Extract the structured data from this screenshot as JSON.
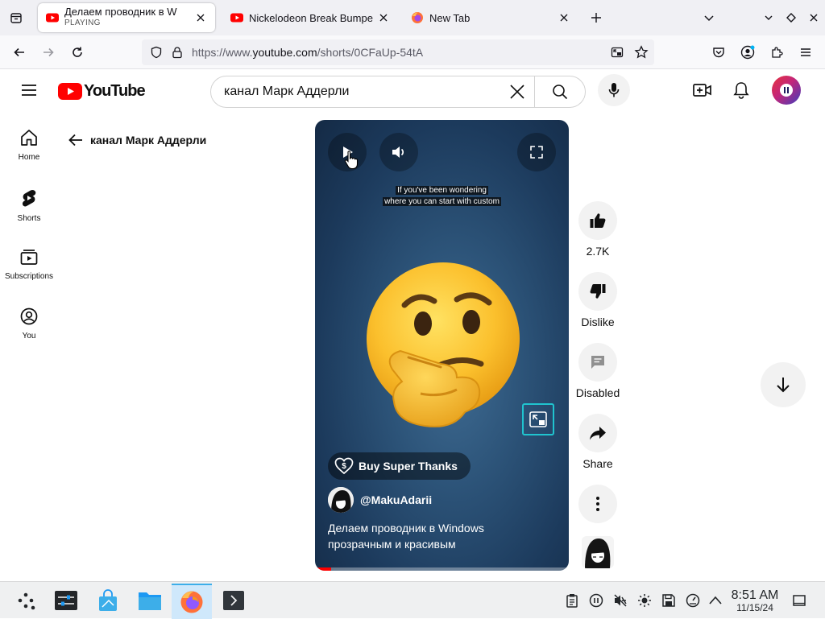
{
  "browser": {
    "tabs": [
      {
        "title": "Делаем проводник в Win",
        "status": "PLAYING",
        "active": true
      },
      {
        "title": "Nickelodeon Break Bumpe",
        "active": false
      },
      {
        "title": "New Tab",
        "active": false
      }
    ],
    "url_prefix": "https://www.",
    "url_domain": "youtube.com",
    "url_path": "/shorts/0CFaUp-54tA"
  },
  "youtube": {
    "logo_text": "YouTube",
    "search_value": "канал Марк Аддерли",
    "sidebar": [
      {
        "label": "Home",
        "icon": "home-icon"
      },
      {
        "label": "Shorts",
        "icon": "shorts-icon"
      },
      {
        "label": "Subscriptions",
        "icon": "subscriptions-icon"
      },
      {
        "label": "You",
        "icon": "you-icon"
      }
    ],
    "back_title": "канал Марк Аддерли",
    "video": {
      "caption_line1": "If you've been wondering",
      "caption_line2": "where you can start with custom",
      "super_thanks": "Buy Super Thanks",
      "channel": "@MakuAdarii",
      "description_line1": "Делаем проводник в Windows",
      "description_line2": "прозрачным и красивым"
    },
    "actions": {
      "like_count": "2.7K",
      "dislike": "Dislike",
      "comments": "Disabled",
      "share": "Share"
    }
  },
  "taskbar": {
    "time": "8:51 AM",
    "date": "11/15/24"
  },
  "colors": {
    "youtube_red": "#ff0000",
    "firefox_blue": "#0060df",
    "video_bg": "#1c3a5c"
  }
}
